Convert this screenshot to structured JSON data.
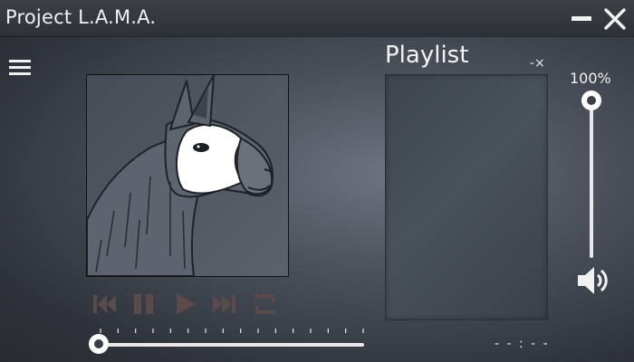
{
  "window": {
    "title": "Project L.A.M.A.",
    "icons": {
      "minimize": "minimize-icon",
      "close": "close-icon"
    }
  },
  "menu": {
    "icon": "hamburger-menu-icon"
  },
  "album_art": {
    "icon": "llama-artwork"
  },
  "controls": {
    "state": "disabled",
    "icons": [
      "previous-track-icon",
      "pause-icon",
      "play-icon",
      "next-track-icon",
      "repeat-icon"
    ],
    "color": "#5a4a4a"
  },
  "seek": {
    "position": 0.0,
    "tick_count": 16
  },
  "playlist": {
    "title": "Playlist",
    "close_label": "-×",
    "items": []
  },
  "time": {
    "display": "- - : - -"
  },
  "volume": {
    "label": "100%",
    "level": 1.0,
    "icon": "speaker-volume-icon"
  }
}
